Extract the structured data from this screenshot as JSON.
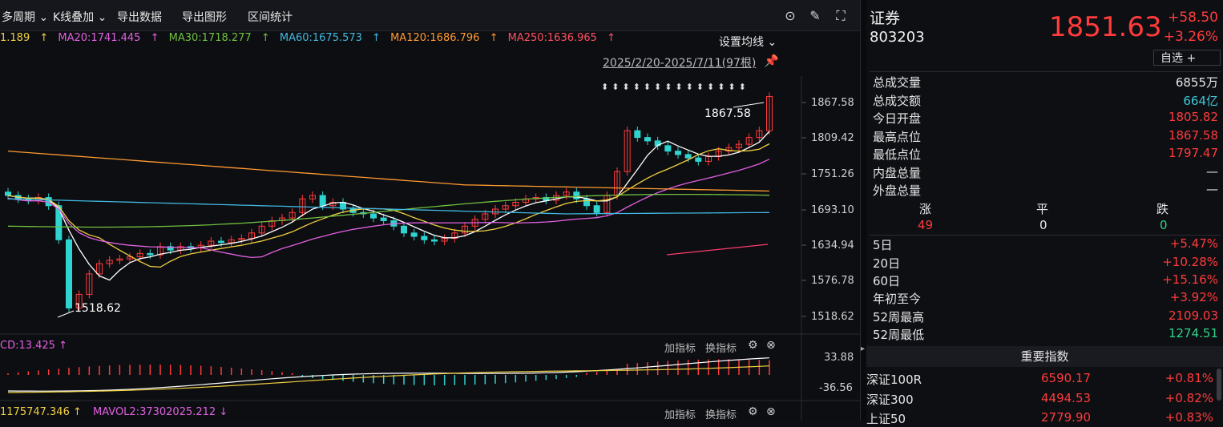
{
  "toolbar": {
    "multi_period": "多周期",
    "kline_overlay": "K线叠加",
    "export_data": "导出数据",
    "export_chart": "导出图形",
    "range_stats": "区间统计"
  },
  "ma": {
    "ma5": "1.189",
    "ma20": "MA20:1741.445",
    "ma30": "MA30:1718.277",
    "ma60": "MA60:1675.573",
    "ma120": "MA120:1686.796",
    "ma250": "MA250:1636.965",
    "settings": "设置均线"
  },
  "range_label": "2025/2/20-2025/7/11(97根)",
  "price_axis": [
    "1867.58",
    "1809.42",
    "1751.26",
    "1693.10",
    "1634.94",
    "1576.78",
    "1518.62"
  ],
  "annot_high": "1867.58",
  "annot_low": "1518.62",
  "macd": {
    "label": "CD:13.425",
    "add": "加指标",
    "switch": "换指标",
    "axis_top": "33.88",
    "axis_bottom": "-36.56"
  },
  "vol": {
    "label1": "1175747.346",
    "label2": "MAVOL2:37302025.212",
    "add": "加指标",
    "switch": "换指标"
  },
  "quote": {
    "name": "证券",
    "code": "803203",
    "price": "1851.63",
    "change": "+58.50",
    "pct": "+3.26%",
    "watch": "自选 +"
  },
  "stats": [
    {
      "label": "总成交量",
      "value": "6855万",
      "color": "white"
    },
    {
      "label": "总成交额",
      "value": "664亿",
      "color": "cyan"
    },
    {
      "label": "今日开盘",
      "value": "1805.82",
      "color": "red"
    },
    {
      "label": "最高点位",
      "value": "1867.58",
      "color": "red"
    },
    {
      "label": "最低点位",
      "value": "1797.47",
      "color": "red"
    },
    {
      "label": "内盘总量",
      "value": "—",
      "color": "white"
    },
    {
      "label": "外盘总量",
      "value": "—",
      "color": "white"
    }
  ],
  "breadth": {
    "up_label": "涨",
    "flat_label": "平",
    "down_label": "跌",
    "up": "49",
    "flat": "0",
    "down": "0"
  },
  "perf": [
    {
      "label": "5日",
      "value": "+5.47%",
      "color": "red"
    },
    {
      "label": "20日",
      "value": "+10.28%",
      "color": "red"
    },
    {
      "label": "60日",
      "value": "+15.16%",
      "color": "red"
    },
    {
      "label": "年初至今",
      "value": "+3.92%",
      "color": "red"
    },
    {
      "label": "52周最高",
      "value": "2109.03",
      "color": "red"
    },
    {
      "label": "52周最低",
      "value": "1274.51",
      "color": "green"
    }
  ],
  "indices_title": "重要指数",
  "indices": [
    {
      "name": "深证100R",
      "value": "6590.17",
      "pct": "+0.81%"
    },
    {
      "name": "深证300",
      "value": "4494.53",
      "pct": "+0.82%"
    },
    {
      "name": "上证50",
      "value": "2779.90",
      "pct": "+0.83%"
    }
  ],
  "colors": {
    "up": "#ff3b3b",
    "down": "#2fd4d0",
    "ma5": "#ffffff",
    "ma10": "#f0d040",
    "ma20": "#e060e0",
    "ma30": "#70c040",
    "ma60": "#40b8e0",
    "ma120": "#ff9a30",
    "ma250": "#ff3b6b"
  }
}
